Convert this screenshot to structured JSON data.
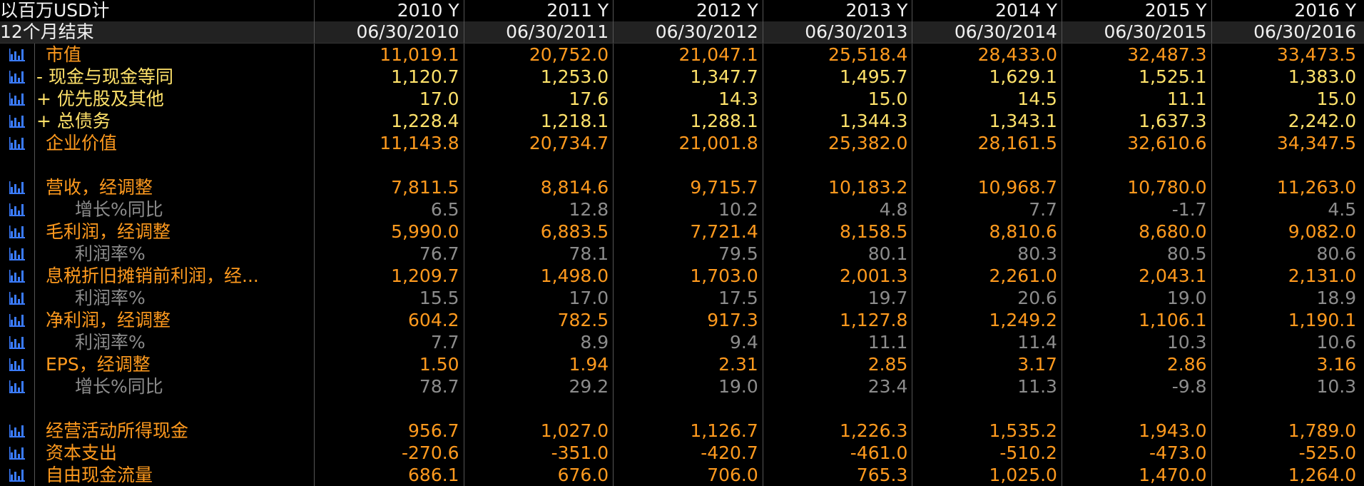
{
  "header": {
    "unit_label": "以百万USD计",
    "period_label": "12个月结束",
    "years": [
      "2010 Y",
      "2011 Y",
      "2012 Y",
      "2013 Y",
      "2014 Y",
      "2015 Y",
      "2016 Y"
    ],
    "dates": [
      "06/30/2010",
      "06/30/2011",
      "06/30/2012",
      "06/30/2013",
      "06/30/2014",
      "06/30/2015",
      "06/30/2016"
    ]
  },
  "rows": [
    {
      "label": "市值",
      "style": "orange",
      "indent": 1,
      "values": [
        "11,019.1",
        "20,752.0",
        "21,047.1",
        "25,518.4",
        "28,433.0",
        "32,487.3",
        "33,473.5"
      ]
    },
    {
      "label": "- 现金与现金等同",
      "style": "yellow",
      "indent": 0,
      "values": [
        "1,120.7",
        "1,253.0",
        "1,347.7",
        "1,495.7",
        "1,629.1",
        "1,525.1",
        "1,383.0"
      ]
    },
    {
      "label": "+ 优先股及其他",
      "style": "yellow",
      "indent": 0,
      "values": [
        "17.0",
        "17.6",
        "14.3",
        "15.0",
        "14.5",
        "11.1",
        "15.0"
      ]
    },
    {
      "label": "+ 总债务",
      "style": "yellow",
      "indent": 0,
      "values": [
        "1,228.4",
        "1,218.1",
        "1,288.1",
        "1,344.3",
        "1,343.1",
        "1,637.3",
        "2,242.0"
      ]
    },
    {
      "label": "企业价值",
      "style": "orange",
      "indent": 1,
      "values": [
        "11,143.8",
        "20,734.7",
        "21,001.8",
        "25,382.0",
        "28,161.5",
        "32,610.6",
        "34,347.5"
      ]
    },
    {
      "spacer": true
    },
    {
      "label": "营收，经调整",
      "style": "orange",
      "indent": 1,
      "values": [
        "7,811.5",
        "8,814.6",
        "9,715.7",
        "10,183.2",
        "10,968.7",
        "10,780.0",
        "11,263.0"
      ]
    },
    {
      "label": "增长%同比",
      "style": "gray",
      "indent": 2,
      "values": [
        "6.5",
        "12.8",
        "10.2",
        "4.8",
        "7.7",
        "-1.7",
        "4.5"
      ]
    },
    {
      "label": "毛利润，经调整",
      "style": "orange",
      "indent": 1,
      "values": [
        "5,990.0",
        "6,883.5",
        "7,721.4",
        "8,158.5",
        "8,810.6",
        "8,680.0",
        "9,082.0"
      ]
    },
    {
      "label": "利润率%",
      "style": "gray",
      "indent": 2,
      "values": [
        "76.7",
        "78.1",
        "79.5",
        "80.1",
        "80.3",
        "80.5",
        "80.6"
      ]
    },
    {
      "label": "息税折旧摊销前利润，经...",
      "style": "orange",
      "indent": 1,
      "values": [
        "1,209.7",
        "1,498.0",
        "1,703.0",
        "2,001.3",
        "2,261.0",
        "2,043.1",
        "2,131.0"
      ]
    },
    {
      "label": "利润率%",
      "style": "gray",
      "indent": 2,
      "values": [
        "15.5",
        "17.0",
        "17.5",
        "19.7",
        "20.6",
        "19.0",
        "18.9"
      ]
    },
    {
      "label": "净利润，经调整",
      "style": "orange",
      "indent": 1,
      "values": [
        "604.2",
        "782.5",
        "917.3",
        "1,127.8",
        "1,249.2",
        "1,106.1",
        "1,190.1"
      ]
    },
    {
      "label": "利润率%",
      "style": "gray",
      "indent": 2,
      "values": [
        "7.7",
        "8.9",
        "9.4",
        "11.1",
        "11.4",
        "10.3",
        "10.6"
      ]
    },
    {
      "label": "EPS，经调整",
      "style": "orange",
      "indent": 1,
      "values": [
        "1.50",
        "1.94",
        "2.31",
        "2.85",
        "3.17",
        "2.86",
        "3.16"
      ]
    },
    {
      "label": "增长%同比",
      "style": "gray",
      "indent": 2,
      "values": [
        "78.7",
        "29.2",
        "19.0",
        "23.4",
        "11.3",
        "-9.8",
        "10.3"
      ]
    },
    {
      "spacer": true
    },
    {
      "label": "经营活动所得现金",
      "style": "orange",
      "indent": 1,
      "values": [
        "956.7",
        "1,027.0",
        "1,126.7",
        "1,226.3",
        "1,535.2",
        "1,943.0",
        "1,789.0"
      ]
    },
    {
      "label": "资本支出",
      "style": "orange",
      "indent": 1,
      "values": [
        "-270.6",
        "-351.0",
        "-420.7",
        "-461.0",
        "-510.2",
        "-473.0",
        "-525.0"
      ]
    },
    {
      "label": "自由现金流量",
      "style": "orange",
      "indent": 1,
      "values": [
        "686.1",
        "676.0",
        "706.0",
        "765.3",
        "1,025.0",
        "1,470.0",
        "1,264.0"
      ]
    }
  ],
  "colors": {
    "orange": "#ff9a1e",
    "yellow": "#ffe26a",
    "gray": "#8c8c8c",
    "icon": "#3a7bff"
  },
  "icon_name": "bar-chart-icon"
}
